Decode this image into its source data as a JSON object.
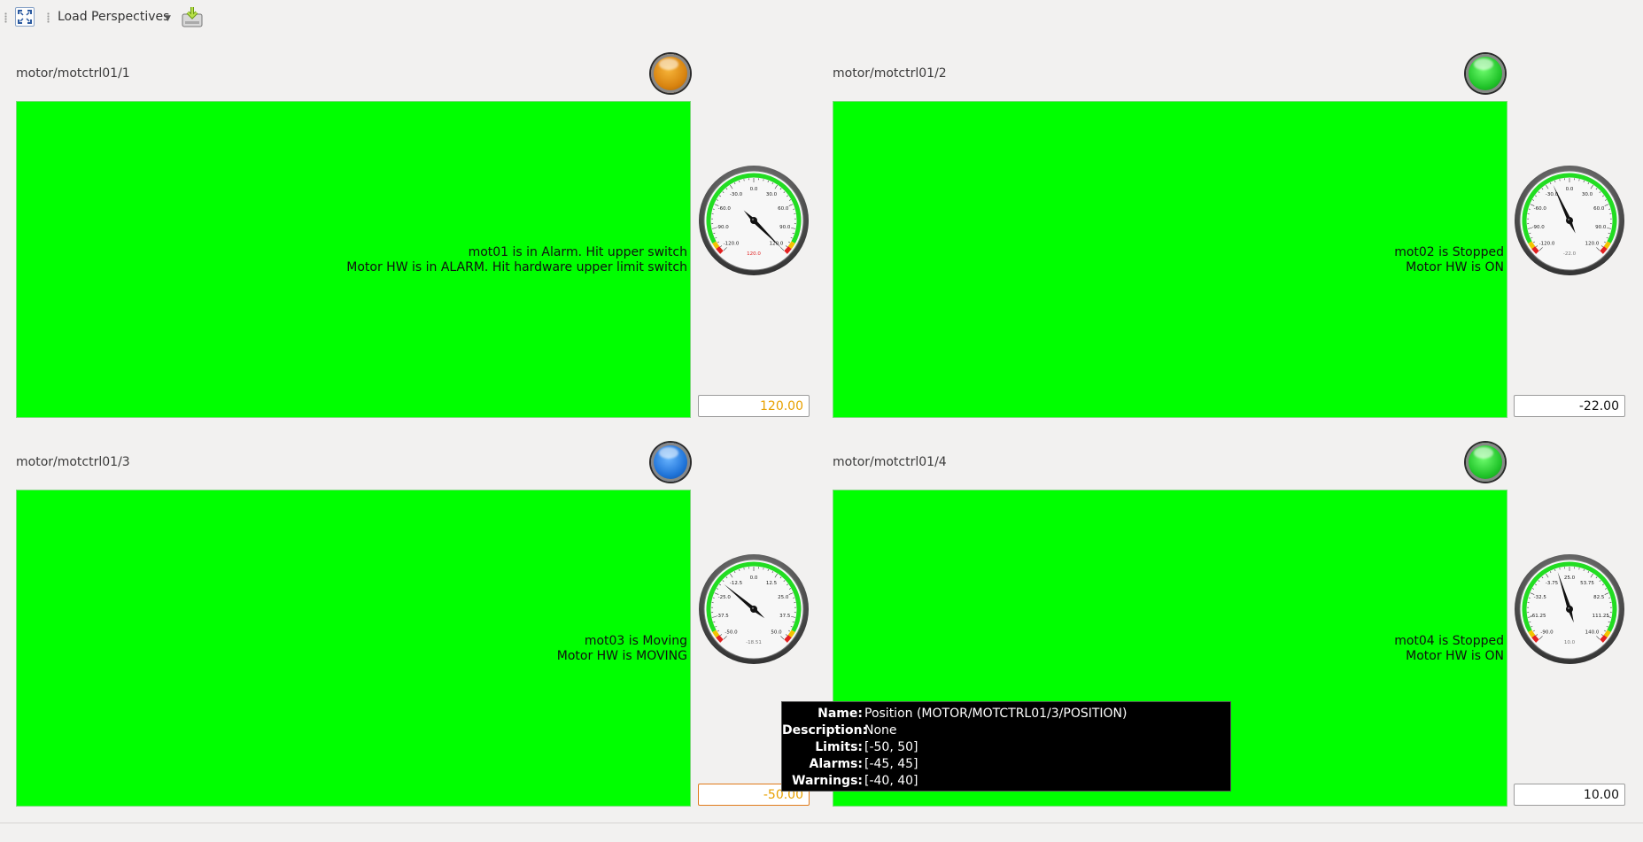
{
  "toolbar": {
    "perspectives_label": "Load Perspectives",
    "fullscreen_icon": "fullscreen-icon",
    "save_icon": "save-perspective-icon"
  },
  "panels": [
    {
      "title": "motor/motctrl01/1",
      "led_color": "orange",
      "state_color": "#00ff00",
      "status_line1": "mot01 is in Alarm. Hit upper switch",
      "status_line2": "Motor HW is in ALARM. Hit hardware upper limit switch",
      "gauge_ticks": [
        "-120.0",
        "-90.0",
        "-60.0",
        "-30.0",
        "0.0",
        "30.0",
        "60.0",
        "90.0",
        "120.0"
      ],
      "gauge_readout": "120.0",
      "gauge_min": -120,
      "gauge_max": 120,
      "gauge_value": 120,
      "value": "120.00"
    },
    {
      "title": "motor/motctrl01/2",
      "led_color": "green",
      "state_color": "#00ff00",
      "status_line1": "mot02 is Stopped",
      "status_line2": "Motor HW is ON",
      "gauge_ticks": [
        "-120.0",
        "-90.0",
        "-60.0",
        "-30.0",
        "0.0",
        "30.0",
        "60.0",
        "90.0",
        "120.0"
      ],
      "gauge_readout": "-22.0",
      "gauge_min": -120,
      "gauge_max": 120,
      "gauge_value": -22,
      "value": "-22.00"
    },
    {
      "title": "motor/motctrl01/3",
      "led_color": "blue",
      "state_color": "#00ff00",
      "status_line1": "mot03 is Moving",
      "status_line2": "Motor HW is MOVING",
      "gauge_ticks": [
        "-50.0",
        "-37.5",
        "-25.0",
        "-12.5",
        "0.0",
        "12.5",
        "25.0",
        "37.5",
        "50.0"
      ],
      "gauge_readout": "-18.51",
      "gauge_min": -50,
      "gauge_max": 50,
      "gauge_value": -18.51,
      "value": "-50.00"
    },
    {
      "title": "motor/motctrl01/4",
      "led_color": "green",
      "state_color": "#00ff00",
      "status_line1": "mot04 is Stopped",
      "status_line2": "Motor HW is ON",
      "gauge_ticks": [
        "-90.0",
        "-61.25",
        "-32.5",
        "-3.75",
        "25.0",
        "53.75",
        "82.5",
        "111.25",
        "140.0"
      ],
      "gauge_readout": "10.0",
      "gauge_min": -90,
      "gauge_max": 140,
      "gauge_value": 10,
      "value": "10.00"
    }
  ],
  "tooltip": {
    "name_key": "Name:",
    "name_val": "Position (MOTOR/MOTCTRL01/3/POSITION)",
    "description_key": "Description:",
    "description_val": "None",
    "limits_key": "Limits:",
    "limits_val": "[-50, 50]",
    "alarms_key": "Alarms:",
    "alarms_val": "[-45, 45]",
    "warnings_key": "Warnings:",
    "warnings_val": "[-40, 40]"
  }
}
